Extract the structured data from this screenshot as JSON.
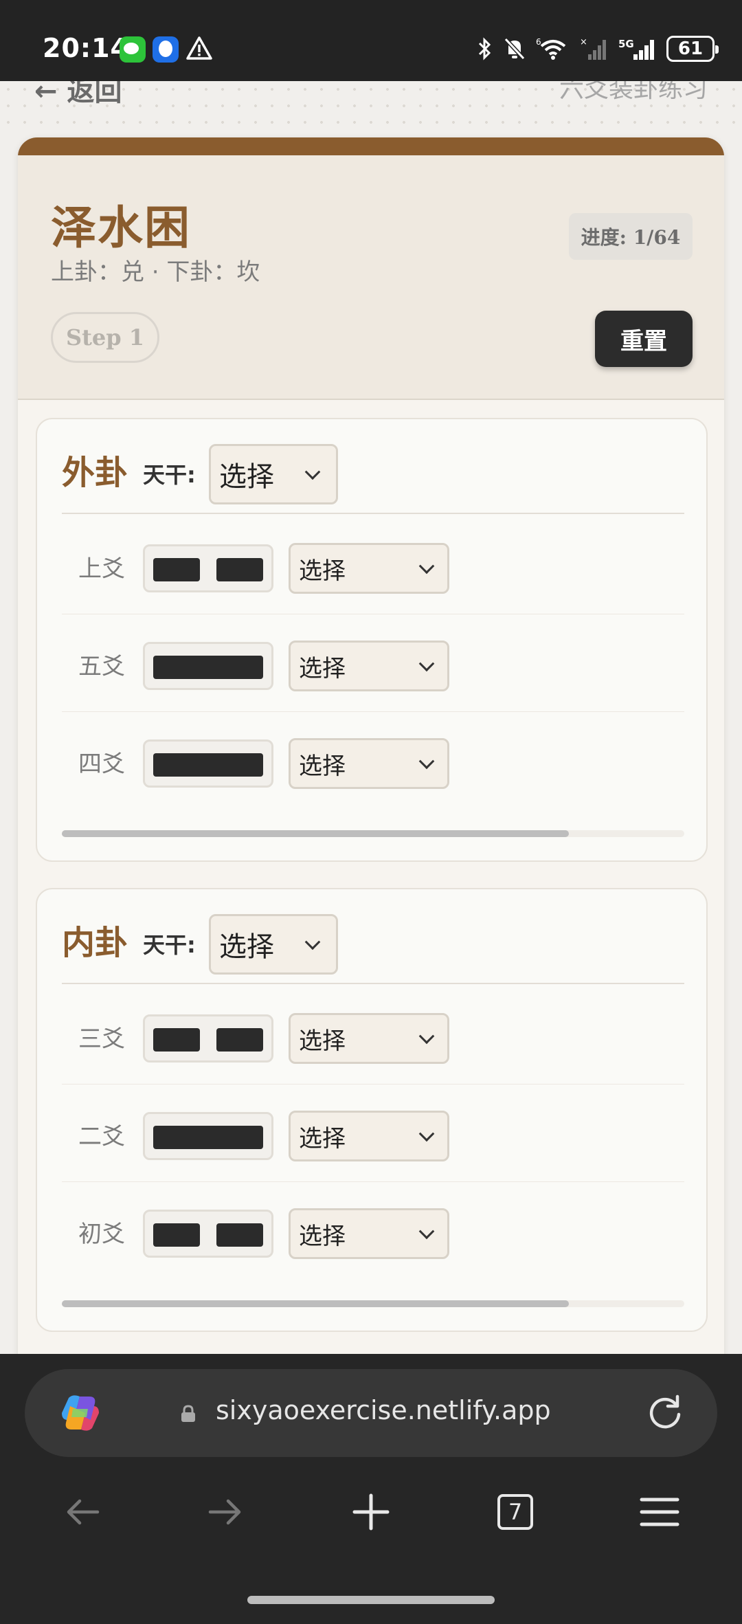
{
  "status_bar": {
    "time": "20:14",
    "icons": [
      "wechat-icon",
      "qq-icon",
      "warning-icon",
      "bluetooth-icon",
      "mute-icon",
      "wifi-icon",
      "signal-icon",
      "signal-5g-icon"
    ],
    "battery": "61"
  },
  "page": {
    "back_label": "← 返回",
    "subtitle_link": "六爻装卦练习"
  },
  "hexagram": {
    "name": "泽水困",
    "trigrams": "上卦：兑 · 下卦：坎",
    "progress": "进度: 1/64",
    "step": "Step 1",
    "reset_label": "重置"
  },
  "outer": {
    "title": "外卦",
    "stem_label": "天干:",
    "stem_value": "选择",
    "lines": [
      {
        "label": "上爻",
        "type": "yin",
        "select": "选择"
      },
      {
        "label": "五爻",
        "type": "yang",
        "select": "选择"
      },
      {
        "label": "四爻",
        "type": "yang",
        "select": "选择"
      }
    ]
  },
  "inner": {
    "title": "内卦",
    "stem_label": "天干:",
    "stem_value": "选择",
    "lines": [
      {
        "label": "三爻",
        "type": "yin",
        "select": "选择"
      },
      {
        "label": "二爻",
        "type": "yang",
        "select": "选择"
      },
      {
        "label": "初爻",
        "type": "yin",
        "select": "选择"
      }
    ]
  },
  "browser": {
    "url": "sixyaoexercise.netlify.app",
    "tab_count": "7"
  },
  "colors": {
    "accent": "#8a5c2e",
    "dark": "#2c2c2c",
    "card_bg": "#f7f4ef"
  }
}
